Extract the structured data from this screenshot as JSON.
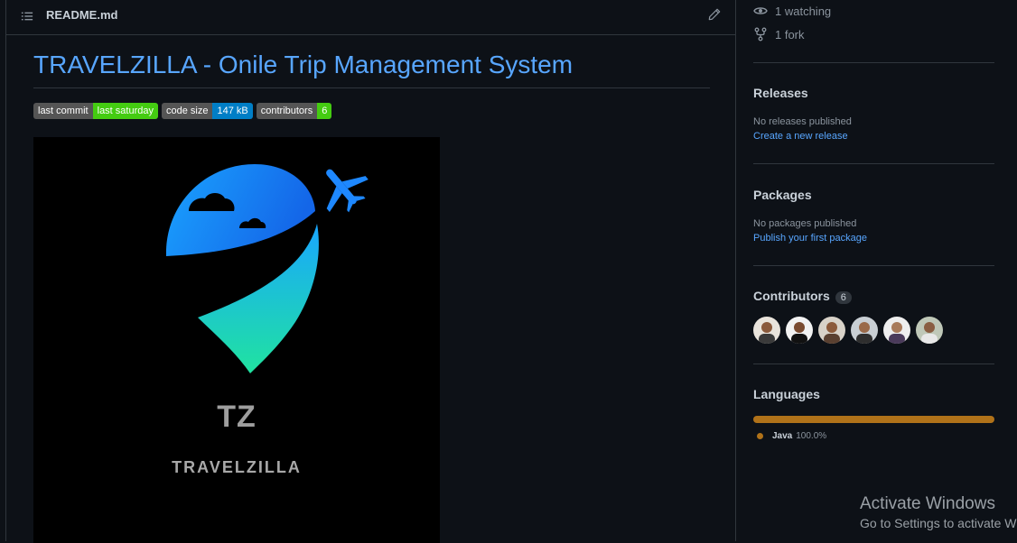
{
  "readme": {
    "file_name": "README.md",
    "title": "TRAVELZILLA - Onile Trip Management System",
    "badges": [
      {
        "key": "last commit",
        "value": "last saturday",
        "color": "#4c1"
      },
      {
        "key": "code size",
        "value": "147 kB",
        "color": "#007ec6"
      },
      {
        "key": "contributors",
        "value": "6",
        "color": "#4c1"
      }
    ],
    "logo": {
      "initials": "TZ",
      "name": "TRAVELZILLA"
    }
  },
  "sidebar": {
    "watching": "1 watching",
    "forks": "1 fork",
    "releases": {
      "title": "Releases",
      "empty_text": "No releases published",
      "link": "Create a new release"
    },
    "packages": {
      "title": "Packages",
      "empty_text": "No packages published",
      "link": "Publish your first package"
    },
    "contributors": {
      "title": "Contributors",
      "count": "6",
      "avatars": [
        "avatar-1",
        "avatar-2",
        "avatar-3",
        "avatar-4",
        "avatar-5",
        "avatar-6"
      ]
    },
    "languages": {
      "title": "Languages",
      "items": [
        {
          "name": "Java",
          "percent": "100.0%",
          "color": "#b07219"
        }
      ]
    }
  },
  "windows_watermark": {
    "line1": "Activate Windows",
    "line2": "Go to Settings to activate W"
  },
  "icons": {
    "list": "list-icon",
    "edit": "pencil-icon",
    "watch": "eye-icon",
    "fork": "fork-icon"
  }
}
